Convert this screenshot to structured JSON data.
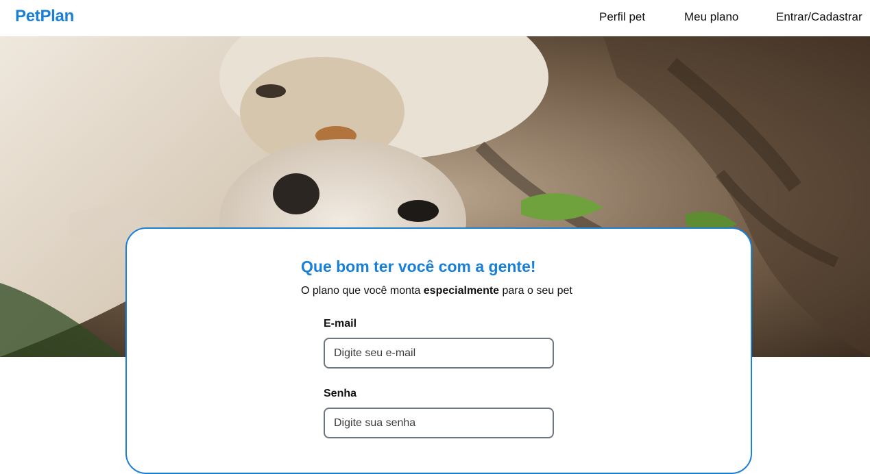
{
  "navbar": {
    "logo": "PetPlan",
    "links": [
      "Perfil pet",
      "Meu plano",
      "Entrar/Cadastrar"
    ]
  },
  "hero": {
    "image": "cat-and-dog-photo"
  },
  "login": {
    "title": "Que bom ter você com a gente!",
    "subtitle_before": "O plano que você monta ",
    "subtitle_bold": "especialmente",
    "subtitle_after": " para o seu pet",
    "email_label": "E-mail",
    "email_placeholder": "Digite seu e-mail",
    "password_label": "Senha",
    "password_placeholder": "Digite sua senha"
  },
  "colors": {
    "brand": "#1a7fd6",
    "text": "#111111",
    "input_border": "#6e7684"
  }
}
